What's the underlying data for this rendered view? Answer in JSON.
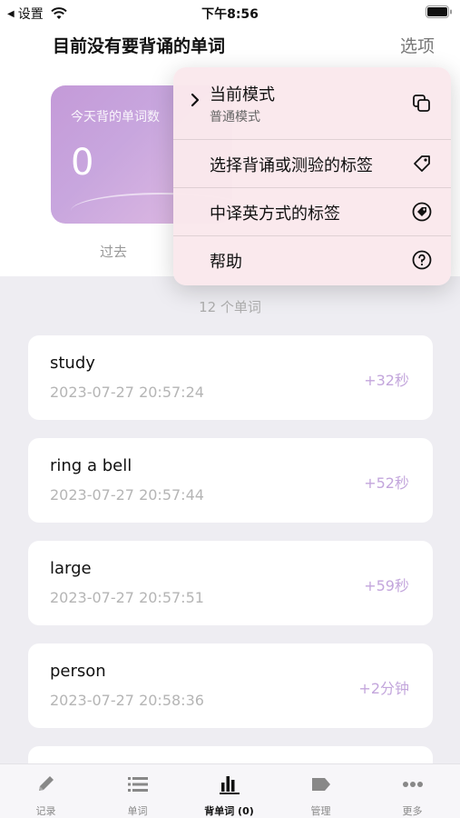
{
  "status_bar": {
    "back_label": "设置",
    "time": "下午8:56"
  },
  "header": {
    "title": "目前没有要背诵的单词",
    "options_label": "选项"
  },
  "stat_card": {
    "label": "今天背的单词数",
    "value": "0"
  },
  "tabs": {
    "past": "过去"
  },
  "menu": {
    "current_mode_title": "当前模式",
    "current_mode_value": "普通模式",
    "select_tags": "选择背诵或测验的标签",
    "cn_en_tags": "中译英方式的标签",
    "help": "帮助"
  },
  "list": {
    "count_label": "12 个单词",
    "items": [
      {
        "word": "study",
        "time": "2023-07-27 20:57:24",
        "duration": "+32秒"
      },
      {
        "word": "ring a bell",
        "time": "2023-07-27 20:57:44",
        "duration": "+52秒"
      },
      {
        "word": "large",
        "time": "2023-07-27 20:57:51",
        "duration": "+59秒"
      },
      {
        "word": "person",
        "time": "2023-07-27 20:58:36",
        "duration": "+2分钟"
      }
    ]
  },
  "tabbar": {
    "items": [
      {
        "label": "记录",
        "icon": "pencil-icon"
      },
      {
        "label": "单词",
        "icon": "list-icon"
      },
      {
        "label": "背单词 (0)",
        "icon": "bar-chart-icon"
      },
      {
        "label": "管理",
        "icon": "tag-icon"
      },
      {
        "label": "更多",
        "icon": "more-icon"
      }
    ],
    "active_index": 2
  },
  "colors": {
    "accent_purple": "#c3a6dc",
    "menu_background": "#fae8ec"
  }
}
